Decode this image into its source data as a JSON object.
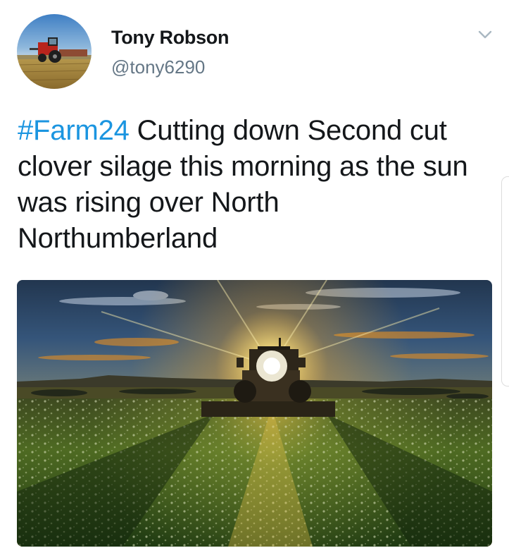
{
  "tweet": {
    "author_name": "Tony Robson",
    "author_handle": "@tony6290",
    "hashtag": "#Farm24",
    "body": " Cutting down Second cut clover silage this morning as the sun was rising over North Northumberland",
    "media_type": "photo"
  },
  "icons": {
    "menu": "chevron-down-icon",
    "avatar": "avatar"
  },
  "colors": {
    "hashtag": "#1b95e0",
    "handle": "#657786",
    "text": "#14171a"
  }
}
